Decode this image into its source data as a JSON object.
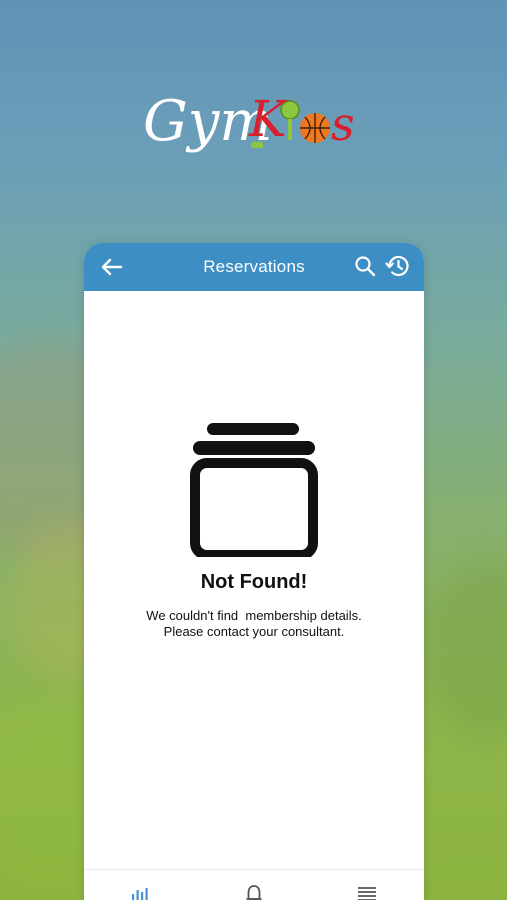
{
  "logo": {
    "text": "GymKids"
  },
  "header": {
    "title": "Reservations",
    "color": "#3d8ec4"
  },
  "empty_state": {
    "title": "Not Found!",
    "message_line1": "We couldn't find  membership details.",
    "message_line2": "Please contact your consultant."
  },
  "icons": {
    "back": "arrow-left-icon",
    "search": "search-icon",
    "history": "history-icon",
    "empty": "jar-icon",
    "nav_stats": "bar-chart-icon",
    "nav_notifications": "bell-icon",
    "nav_menu": "menu-icon"
  }
}
